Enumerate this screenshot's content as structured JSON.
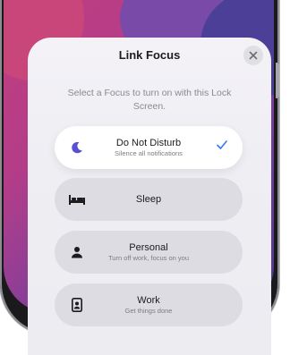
{
  "sheet": {
    "title": "Link Focus",
    "subtitle": "Select a Focus to turn on with this Lock Screen."
  },
  "focus_options": [
    {
      "label": "Do Not Disturb",
      "description": "Silence all notifications",
      "icon": "moon-icon",
      "selected": true
    },
    {
      "label": "Sleep",
      "description": "",
      "icon": "bed-icon",
      "selected": false
    },
    {
      "label": "Personal",
      "description": "Turn off work, focus on you",
      "icon": "person-icon",
      "selected": false
    },
    {
      "label": "Work",
      "description": "Get things done",
      "icon": "id-badge-icon",
      "selected": false
    }
  ],
  "colors": {
    "accent": "#5a4fd0",
    "checkmark": "#3478f6",
    "sheet_background": "#eeeef3",
    "option_background": "#dddce2"
  }
}
